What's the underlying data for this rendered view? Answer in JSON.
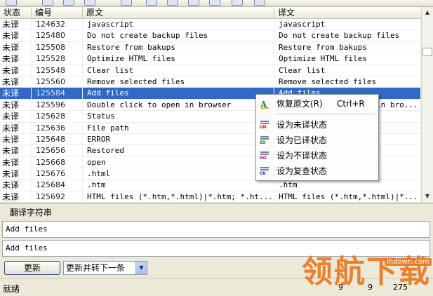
{
  "grid": {
    "headers": {
      "status": "状态",
      "id": "编号",
      "source": "原文",
      "translation": "译文"
    },
    "rows": [
      {
        "status": "未译",
        "id": "124632",
        "source": "javascript",
        "translation": "javascript"
      },
      {
        "status": "未译",
        "id": "125480",
        "source": "Do not create backup files",
        "translation": "Do not create backup files"
      },
      {
        "status": "未译",
        "id": "125508",
        "source": "Restore from bakups",
        "translation": "Restore from bakups"
      },
      {
        "status": "未译",
        "id": "125528",
        "source": "Optimize HTML files",
        "translation": "Optimize HTML files"
      },
      {
        "status": "未译",
        "id": "125548",
        "source": "Clear list",
        "translation": "Clear list"
      },
      {
        "status": "未译",
        "id": "125560",
        "source": "Remove selected files",
        "translation": "Remove selected files"
      },
      {
        "status": "未译",
        "id": "125584",
        "source": "Add files",
        "translation": "Add files",
        "selected": true
      },
      {
        "status": "未译",
        "id": "125596",
        "source": "Double click to open in browser",
        "translation": "Double click to open in bro..."
      },
      {
        "status": "未译",
        "id": "125628",
        "source": "Status",
        "translation": ""
      },
      {
        "status": "未译",
        "id": "125636",
        "source": "File path",
        "translation": ""
      },
      {
        "status": "未译",
        "id": "125648",
        "source": "ERROR",
        "translation": ""
      },
      {
        "status": "未译",
        "id": "125656",
        "source": "Restored",
        "translation": ""
      },
      {
        "status": "未译",
        "id": "125668",
        "source": "open",
        "translation": ""
      },
      {
        "status": "未译",
        "id": "125676",
        "source": ".html",
        "translation": ""
      },
      {
        "status": "未译",
        "id": "125684",
        "source": ".htm",
        "translation": ".htm"
      },
      {
        "status": "未译",
        "id": "125692",
        "source": "HTML files (*.htm,*.html)|*.htm; *.ht...",
        "translation": "HTML files (*.htm,*.html)|*..."
      }
    ]
  },
  "context_menu": {
    "items": [
      {
        "label": "恢复原文(R)",
        "shortcut": "Ctrl+R",
        "icon": "restore-icon"
      },
      {
        "label": "设为未译状态",
        "shortcut": "",
        "icon": "untranslated-icon",
        "tag": "UN",
        "tag_color": "#cc2222"
      },
      {
        "label": "设为已译状态",
        "shortcut": "",
        "icon": "translated-icon",
        "tag": "ED",
        "tag_color": "#1f8a2e"
      },
      {
        "label": "设为不译状态",
        "shortcut": "",
        "icon": "no-translate-icon",
        "tag": "NO",
        "tag_color": "#c21d8f"
      },
      {
        "label": "设为复查状态",
        "shortcut": "",
        "icon": "review-icon",
        "tag": "CK",
        "tag_color": "#1d3fc2"
      }
    ]
  },
  "editor": {
    "caption": "翻译字符串",
    "source_text": "Add files",
    "translation_text": "Add files",
    "update_button": "更新",
    "update_next_option": "更新并转下一条"
  },
  "statusbar": {
    "text": "就绪",
    "values": [
      "9",
      "9",
      "275"
    ]
  },
  "watermark": {
    "text": "领航下载",
    "url": "lhdown.com"
  },
  "colors": {
    "selection": "#316ac5",
    "window_bg": "#ece9d8",
    "watermark": "#e87a22"
  }
}
